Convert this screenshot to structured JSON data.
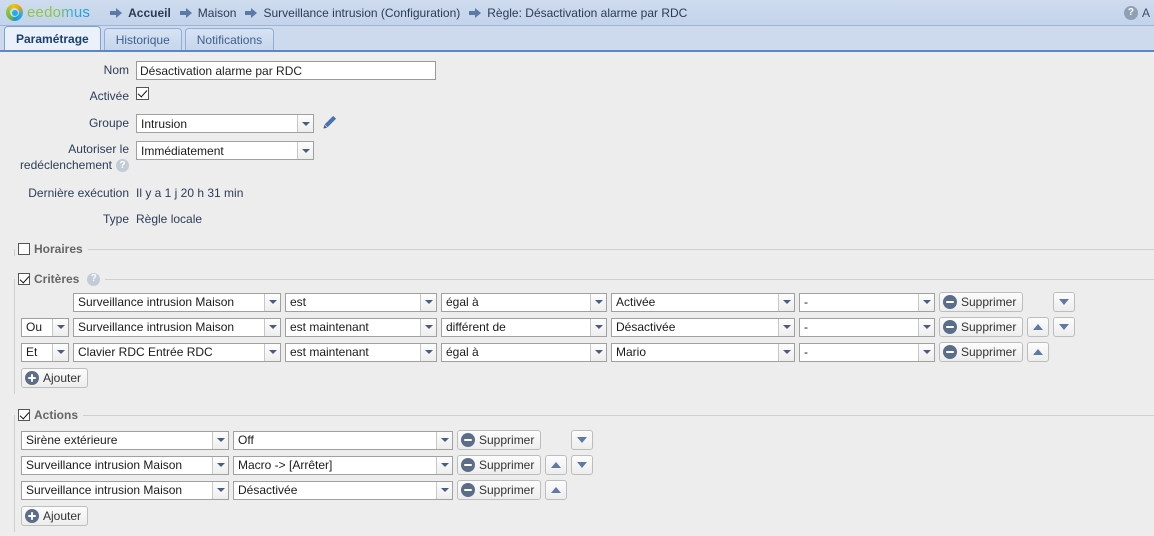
{
  "header": {
    "logo_text": "eedomus",
    "breadcrumbs": [
      {
        "label": "Accueil",
        "icon": "arrow-right-icon",
        "bold": true
      },
      {
        "label": "Maison",
        "icon": "arrow-right-icon",
        "bold": false
      },
      {
        "label": "Surveillance intrusion (Configuration)",
        "icon": "arrow-right-icon",
        "bold": false
      },
      {
        "label": "Règle: Désactivation alarme par RDC",
        "icon": "arrow-right-icon",
        "bold": false
      }
    ],
    "help_icon": "help-icon",
    "help_label": "?",
    "account_initial": "A"
  },
  "tabs": [
    {
      "label": "Paramétrage",
      "active": true
    },
    {
      "label": "Historique",
      "active": false
    },
    {
      "label": "Notifications",
      "active": false
    }
  ],
  "form": {
    "name_label": "Nom",
    "name_value": "Désactivation alarme par RDC",
    "name_placeholder": "",
    "enabled_label": "Activée",
    "enabled_checked": true,
    "group_label": "Groupe",
    "group_value": "Intrusion",
    "edit_icon": "pencil-icon",
    "retrigger_label_line1": "Autoriser le",
    "retrigger_label_line2": "redéclenchement",
    "retrigger_help": "?",
    "retrigger_value": "Immédiatement",
    "last_exec_label": "Dernière exécution",
    "last_exec_value": "Il y a 1 j 20 h 31 min",
    "type_label": "Type",
    "type_value": "Règle locale"
  },
  "schedules": {
    "legend": "Horaires",
    "checked": false
  },
  "criteria": {
    "legend": "Critères",
    "checked": true,
    "help": "?",
    "delete_label": "Supprimer",
    "add_label": "Ajouter",
    "rows": [
      {
        "operator": "",
        "has_operator": false,
        "device": "Surveillance intrusion Maison",
        "condition": "est",
        "comparator": "égal à",
        "value": "Activée",
        "extra": "-",
        "move_up": false,
        "move_down": true
      },
      {
        "operator": "Ou",
        "has_operator": true,
        "device": "Surveillance intrusion Maison",
        "condition": "est maintenant",
        "comparator": "différent de",
        "value": "Désactivée",
        "extra": "-",
        "move_up": true,
        "move_down": true
      },
      {
        "operator": "Et",
        "has_operator": true,
        "device": "Clavier RDC Entrée RDC",
        "condition": "est maintenant",
        "comparator": "égal à",
        "value": "Mario",
        "extra": "-",
        "move_up": true,
        "move_down": false
      }
    ]
  },
  "actions": {
    "legend": "Actions",
    "checked": true,
    "delete_label": "Supprimer",
    "add_label": "Ajouter",
    "rows": [
      {
        "device": "Sirène extérieure",
        "value": "Off",
        "move_up": false,
        "move_down": true
      },
      {
        "device": "Surveillance intrusion Maison",
        "value": "Macro -> [Arrêter]",
        "move_up": true,
        "move_down": true
      },
      {
        "device": "Surveillance intrusion Maison",
        "value": "Désactivée",
        "move_up": true,
        "move_down": false
      }
    ]
  },
  "colors": {
    "header_bg": "#c8d8ee",
    "tab_active_bg": "#eaf1fa",
    "tab_border": "#5b87c5",
    "page_bg": "#ededed",
    "icon_slate": "#5c6d8a"
  }
}
